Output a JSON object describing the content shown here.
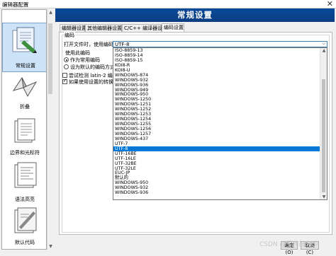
{
  "window": {
    "title": "编辑器配置",
    "close_glyph": "✕"
  },
  "banner": {
    "title": "常规设置"
  },
  "sidebar": {
    "items": [
      {
        "label": "常规设置",
        "icon": "settings-page-icon",
        "active": true
      },
      {
        "label": "折叠",
        "icon": "folding-icon",
        "active": false
      },
      {
        "label": "边界和光标符",
        "icon": "margins-icon",
        "active": false
      },
      {
        "label": "语法高亮",
        "icon": "syntax-highlight-icon",
        "active": false
      },
      {
        "label": "默认代码",
        "icon": "default-code-icon",
        "active": false
      }
    ]
  },
  "tabs": [
    {
      "label": "编辑器设置",
      "active": false
    },
    {
      "label": "其他编辑器设置",
      "active": false
    },
    {
      "label": "C/C++ 编译器设置",
      "active": false
    },
    {
      "label": "编码设置",
      "active": true
    }
  ],
  "encoding": {
    "group_title": "编码",
    "open_file_label": "打开文件时，使用编码：",
    "selected": "UTF-8",
    "use_this_encoding_label": "使用此编码",
    "radio_common": "作为常用编码",
    "radio_default": "设为默认的编码方式（",
    "check_latin2": "尝试检测 latin-2 编码类",
    "check_convert": "如果使用设置的转换失"
  },
  "dropdown_options": [
    "ISO-8859-13",
    "ISO-8859-14",
    "ISO-8859-15",
    "KOI8-R",
    "KOI8-U",
    "WINDOWS-874",
    "WINDOWS-932",
    "WINDOWS-936",
    "WINDOWS-949",
    "WINDOWS-950",
    "WINDOWS-1250",
    "WINDOWS-1251",
    "WINDOWS-1252",
    "WINDOWS-1253",
    "WINDOWS-1254",
    "WINDOWS-1255",
    "WINDOWS-1256",
    "WINDOWS-1257",
    "WINDOWS-437",
    "UTF-7",
    "UTF-8",
    "UTF-16BE",
    "UTF-16LE",
    "UTF-32BE",
    "UTF-32LE",
    "EUC-JP",
    "默认的",
    "WINDOWS-950",
    "WINDOWS-932",
    "WINDOWS-936"
  ],
  "dropdown_selected_index": 20,
  "buttons": {
    "ok": "确定(O)",
    "cancel": "取消(C)"
  },
  "watermark": "CSDN @写代码的小"
}
